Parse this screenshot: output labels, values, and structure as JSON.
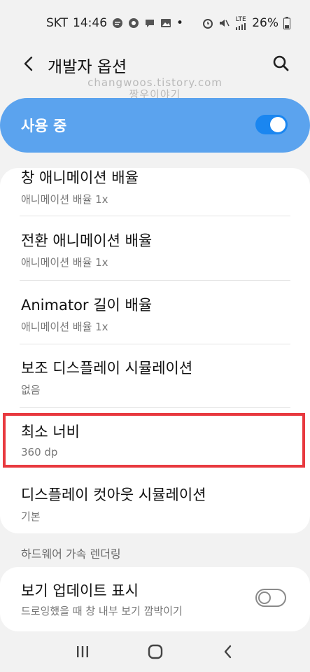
{
  "status_bar": {
    "carrier": "SKT",
    "time": "14:46",
    "battery": "26%",
    "dot": "•",
    "lte": "LTE",
    "icons": [
      "message-icon",
      "sale-icon",
      "chat-icon",
      "image-icon",
      "alarm-icon",
      "mute-icon",
      "lte-signal-icon",
      "battery-icon"
    ]
  },
  "appbar": {
    "title": "개발자 옵션",
    "back_icon": "back-arrow-icon",
    "search_icon": "search-icon"
  },
  "watermark": {
    "line1": "changwoos.tistory.com",
    "line2": "짱우이야기"
  },
  "master_switch": {
    "label": "사용 중",
    "state": "on",
    "color": "#5ba3ee",
    "toggle_color": "#1a86f0"
  },
  "settings": [
    {
      "title": "창 애니메이션 배율",
      "subtitle": "애니메이션 배율 1x"
    },
    {
      "title": "전환 애니메이션 배율",
      "subtitle": "애니메이션 배율 1x"
    },
    {
      "title": "Animator 길이 배율",
      "subtitle": "애니메이션 배율 1x"
    },
    {
      "title": "보조 디스플레이 시뮬레이션",
      "subtitle": "없음"
    },
    {
      "title": "최소 너비",
      "subtitle": "360 dp",
      "highlighted": true
    },
    {
      "title": "디스플레이 컷아웃 시뮬레이션",
      "subtitle": "기본"
    }
  ],
  "highlight_color": "#e8393f",
  "section_hardware": {
    "header": "하드웨어 가속 렌더링",
    "items": [
      {
        "title": "보기 업데이트 표시",
        "subtitle": "드로잉했을 때 창 내부 보기 깜박이기",
        "toggle": "off"
      }
    ]
  },
  "nav_bar": {
    "icons": [
      "recent-apps-icon",
      "home-icon",
      "back-icon"
    ]
  }
}
